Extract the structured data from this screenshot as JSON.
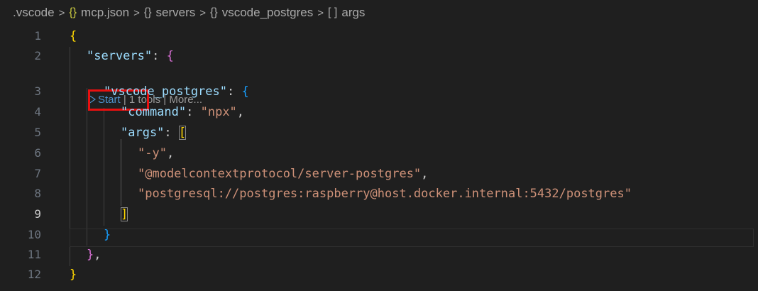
{
  "breadcrumb": {
    "items": [
      {
        "label": ".vscode",
        "icon": ""
      },
      {
        "label": "mcp.json",
        "icon": "{}"
      },
      {
        "label": "servers",
        "icon": "{}"
      },
      {
        "label": "vscode_postgres",
        "icon": "{}"
      },
      {
        "label": "args",
        "icon": "[ ]"
      }
    ],
    "separator": ">"
  },
  "codelens": {
    "start_label": "Start",
    "sep1": " | ",
    "tools_label": "1 tools",
    "sep2": " | ",
    "more_label": "More..."
  },
  "lines": [
    {
      "num": "1"
    },
    {
      "num": "2"
    },
    {
      "num": "3"
    },
    {
      "num": "4"
    },
    {
      "num": "5"
    },
    {
      "num": "6"
    },
    {
      "num": "7"
    },
    {
      "num": "8"
    },
    {
      "num": "9"
    },
    {
      "num": "10"
    },
    {
      "num": "11"
    },
    {
      "num": "12"
    }
  ],
  "code": {
    "l1_open": "{",
    "l2_key": "\"servers\"",
    "l2_colon": ": ",
    "l2_open": "{",
    "l3_key": "\"vscode_postgres\"",
    "l3_colon": ": ",
    "l3_open": "{",
    "l4_key": "\"command\"",
    "l4_colon": ": ",
    "l4_val": "\"npx\"",
    "l4_comma": ",",
    "l5_key": "\"args\"",
    "l5_colon": ": ",
    "l5_open": "[",
    "l6_val": "\"-y\"",
    "l6_comma": ",",
    "l7_val": "\"@modelcontextprotocol/server-postgres\"",
    "l7_comma": ",",
    "l8_val": "\"postgresql://postgres:raspberry@host.docker.internal:5432/postgres\"",
    "l9_close": "]",
    "l10_close": "}",
    "l11_close": "}",
    "l11_comma": ",",
    "l12_close": "}"
  },
  "colors": {
    "background": "#1f1f1f",
    "key": "#9cdcfe",
    "string": "#ce9178",
    "bracket_level1": "#ffd700",
    "bracket_level2": "#da70d6",
    "bracket_level3": "#179fff",
    "codelens_link": "#4e94ce",
    "highlight_box": "#e81010"
  }
}
